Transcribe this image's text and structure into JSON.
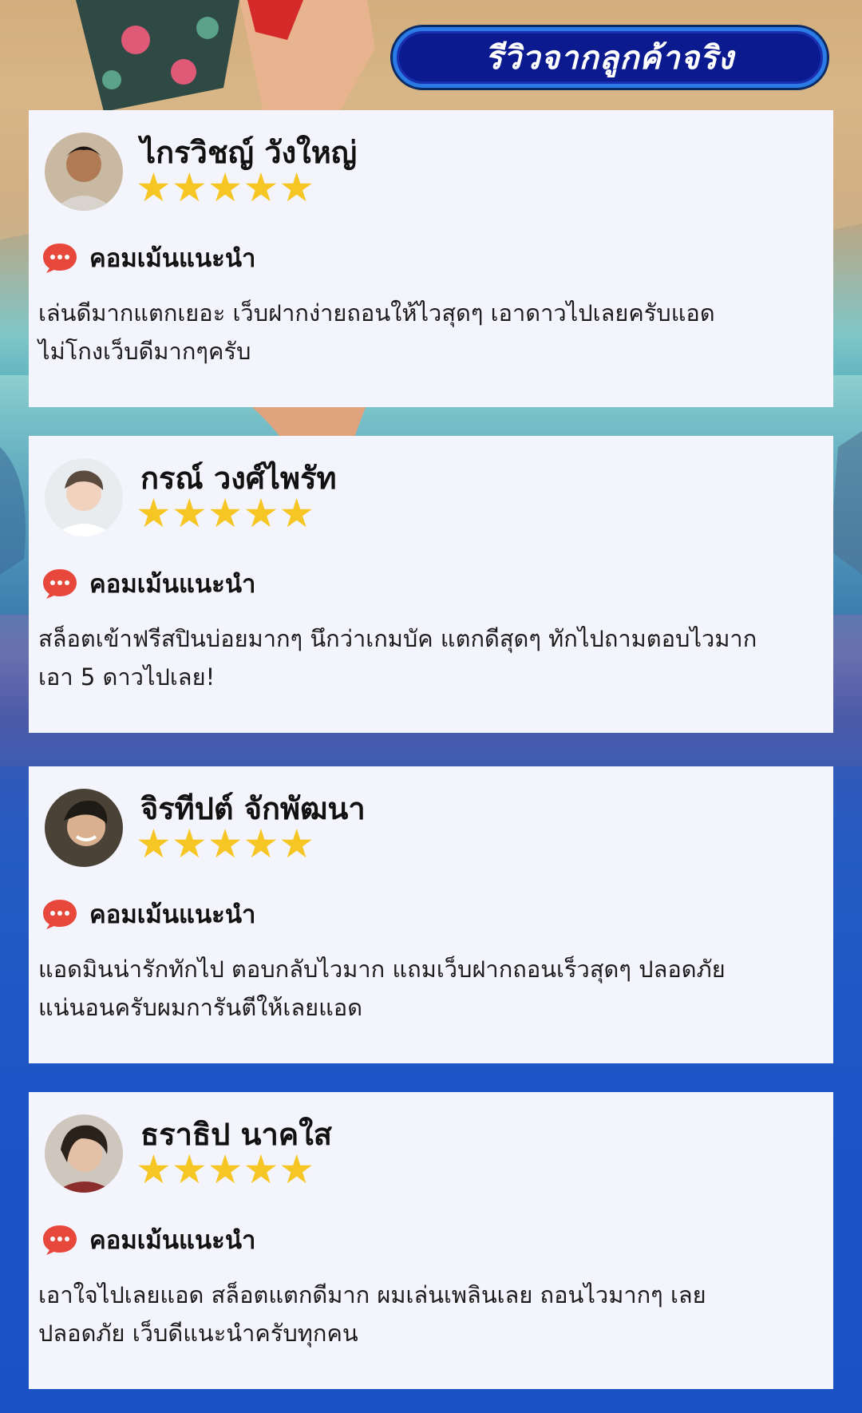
{
  "header": {
    "title": "รีวิวจากลูกค้าจริง"
  },
  "colors": {
    "title_bg": "#0b1a8f",
    "title_border": "#2a7be6",
    "card_bg": "#f4f4fd",
    "star": "#f6c624",
    "chat_bubble": "#e8473c"
  },
  "reviews": [
    {
      "name": "ไกรวิชญ์ วังใหญ่",
      "stars": "★★★★★",
      "rating": 5,
      "comment_label": "คอมเม้นแนะนำ",
      "line1": "เล่นดีมากแตกเยอะ เว็บฝากง่ายถอนให้ไวสุดๆ เอาดาวไปเลยครับแอด",
      "line2": "ไม่โกงเว็บดีมากๆครับ",
      "avatar_icon": "person-avatar"
    },
    {
      "name": "กรณ์ วงศ์ไพรัท",
      "stars": "★★★★★",
      "rating": 5,
      "comment_label": "คอมเม้นแนะนำ",
      "line1": "สล็อตเข้าฟรีสปินบ่อยมากๆ นึกว่าเกมบัค แตกดีสุดๆ ทักไปถามตอบไวมาก",
      "line2": "เอา 5 ดาวไปเลย!",
      "avatar_icon": "person-avatar"
    },
    {
      "name": "จิรทีปต์ จักพัฒนา",
      "stars": "★★★★★",
      "rating": 5,
      "comment_label": "คอมเม้นแนะนำ",
      "line1": "แอดมินน่ารักทักไป ตอบกลับไวมาก แถมเว็บฝากถอนเร็วสุดๆ ปลอดภัย",
      "line2": "แน่นอนครับผมการันตีให้เลยแอด",
      "avatar_icon": "person-avatar"
    },
    {
      "name": "ธราธิป นาคใส",
      "stars": "★★★★★",
      "rating": 5,
      "comment_label": "คอมเม้นแนะนำ",
      "line1": "เอาใจไปเลยแอด สล็อตแตกดีมาก ผมเล่นเพลินเลย ถอนไวมากๆ เลย",
      "line2": "ปลอดภัย เว็บดีแนะนำครับทุกคน",
      "avatar_icon": "person-avatar"
    }
  ]
}
